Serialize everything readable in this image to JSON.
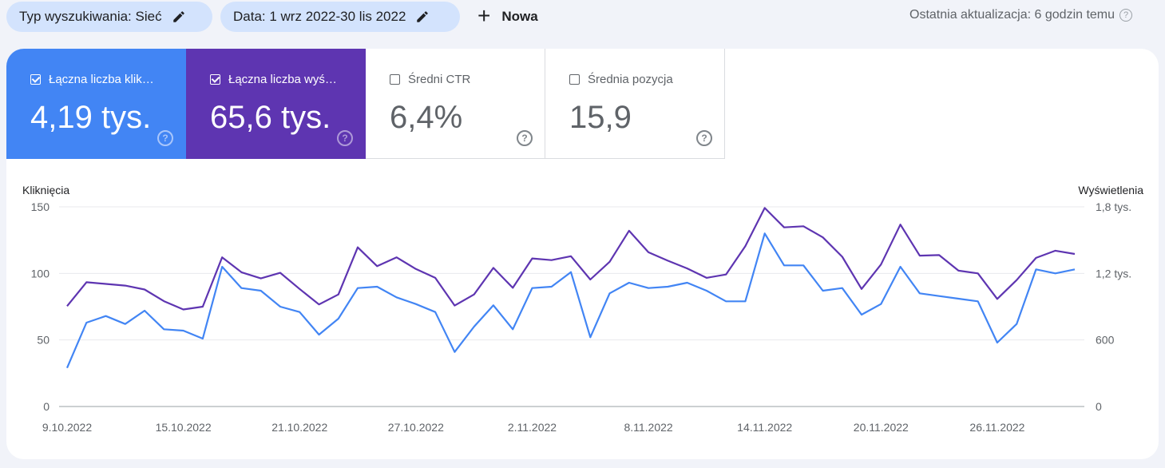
{
  "filters": {
    "search_type": "Typ wyszukiwania: Sieć",
    "date": "Data: 1 wrz 2022-30 lis 2022",
    "new_label": "Nowa"
  },
  "last_update": "Ostatnia aktualizacja: 6 godzin temu",
  "metrics": [
    {
      "label": "Łączna liczba klik…",
      "value": "4,19 tys.",
      "checked": true,
      "color": "#4285f4"
    },
    {
      "label": "Łączna liczba wyś…",
      "value": "65,6 tys.",
      "checked": true,
      "color": "#5e35b1"
    },
    {
      "label": "Średni CTR",
      "value": "6,4%",
      "checked": false
    },
    {
      "label": "Średnia pozycja",
      "value": "15,9",
      "checked": false
    }
  ],
  "chart_data": {
    "type": "line",
    "left_axis_label": "Kliknięcia",
    "right_axis_label": "Wyświetlenia",
    "left_ticks": [
      "0",
      "50",
      "100",
      "150"
    ],
    "right_ticks": [
      "0",
      "600",
      "1,2 tys.",
      "1,8 tys."
    ],
    "x_tick_labels": [
      "9.10.2022",
      "15.10.2022",
      "21.10.2022",
      "27.10.2022",
      "2.11.2022",
      "8.11.2022",
      "14.11.2022",
      "20.11.2022",
      "26.11.2022"
    ],
    "x_tick_indices": [
      0,
      6,
      12,
      18,
      24,
      30,
      36,
      42,
      48
    ],
    "ylim_left": [
      0,
      150
    ],
    "ylim_right": [
      0,
      1800
    ],
    "grid": true,
    "series": [
      {
        "name": "Łączna liczba kliknięć",
        "axis": "left",
        "color": "#4285f4",
        "values": [
          29,
          63,
          68,
          62,
          72,
          58,
          57,
          51,
          105,
          89,
          87,
          75,
          71,
          54,
          66,
          89,
          90,
          82,
          77,
          71,
          41,
          60,
          76,
          58,
          89,
          90,
          101,
          52,
          85,
          93,
          89,
          90,
          93,
          87,
          79,
          79,
          130,
          106,
          106,
          87,
          89,
          69,
          77,
          105,
          85,
          83,
          81,
          79,
          48,
          62,
          103,
          100,
          103
        ]
      },
      {
        "name": "Łączna liczba wyświetleń",
        "axis": "right",
        "color": "#5e35b1",
        "values": [
          905,
          1120,
          1105,
          1090,
          1055,
          950,
          875,
          900,
          1345,
          1210,
          1155,
          1205,
          1060,
          920,
          1010,
          1435,
          1265,
          1345,
          1240,
          1160,
          910,
          1010,
          1250,
          1070,
          1335,
          1320,
          1355,
          1145,
          1305,
          1585,
          1390,
          1315,
          1245,
          1160,
          1190,
          1445,
          1790,
          1615,
          1625,
          1525,
          1350,
          1060,
          1280,
          1640,
          1360,
          1365,
          1225,
          1200,
          970,
          1140,
          1340,
          1405,
          1375
        ]
      }
    ]
  }
}
